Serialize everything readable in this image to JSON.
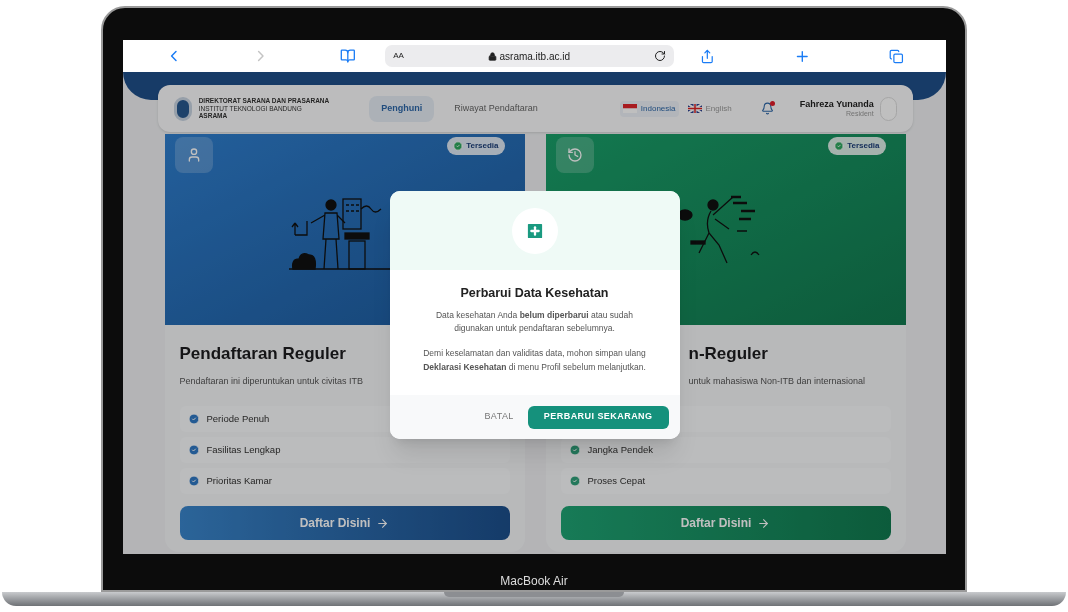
{
  "browser": {
    "text_size_button": "AA",
    "url": "asrama.itb.ac.id"
  },
  "header": {
    "org_lines": [
      "DIREKTORAT SARANA DAN PRASARANA",
      "INSTITUT TEKNOLOGI BANDUNG",
      "ASRAMA"
    ],
    "nav": [
      {
        "label": "Penghuni",
        "selected": true
      },
      {
        "label": "Riwayat Pendaftaran",
        "selected": false
      }
    ],
    "languages": [
      {
        "label": "Indonesia",
        "selected": true
      },
      {
        "label": "English",
        "selected": false
      }
    ],
    "notification_dot": true,
    "user": {
      "name": "Fahreza Yunanda",
      "role": "Resident"
    }
  },
  "cards": [
    {
      "kind": "full",
      "badge": "Tersedia",
      "title": "Pendaftaran Reguler",
      "description": "Pendaftaran ini diperuntukan untuk civitas ITB",
      "features": [
        {
          "kind": "item",
          "label": "Periode Penuh"
        },
        {
          "kind": "item",
          "label": "Fasilitas Lengkap"
        },
        {
          "kind": "item",
          "label": "Prioritas Kamar"
        }
      ],
      "button": "Daftar Disini"
    },
    {
      "kind": "partly_covered",
      "badge": "Tersedia",
      "title": "n-Reguler",
      "description": "untuk mahasiswa Non-ITB dan internasional",
      "features": [
        {
          "kind": "covered"
        },
        {
          "kind": "item",
          "label": "Jangka Pendek"
        },
        {
          "kind": "item",
          "label": "Proses Cepat"
        }
      ],
      "button": "Daftar Disini"
    }
  ],
  "dialog": {
    "title": "Perbarui Data Kesehatan",
    "paragraphs": [
      "Data kesehatan Anda **belum diperbarui** atau sudah digunakan untuk pendaftaran sebelumnya.",
      "Demi keselamatan dan validitas data, mohon simpan ulang **Deklarasi Kesehatan** di menu Profil sebelum melanjutkan."
    ],
    "cancel": "BATAL",
    "confirm": "PERBARUI SEKARANG"
  },
  "device_label": "MacBook Air"
}
